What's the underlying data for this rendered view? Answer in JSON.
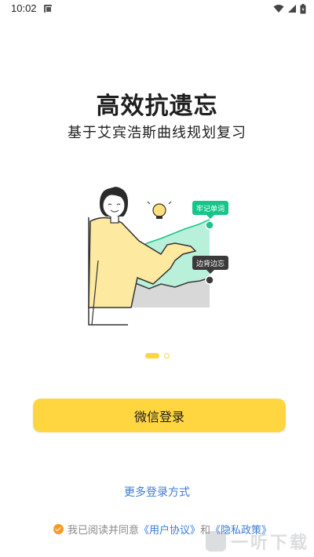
{
  "status_bar": {
    "time": "10:02",
    "icons": [
      "notification-icon",
      "wifi-icon",
      "signal-icon",
      "battery-icon"
    ]
  },
  "headline": "高效抗遗忘",
  "subhead": "基于艾宾浩斯曲线规划复习",
  "illustration": {
    "label_top": "牢记单词",
    "label_bottom": "边背边忘",
    "colors": {
      "green": "#19c48b",
      "dark": "#3a3a3a",
      "yellow": "#fde9a0"
    }
  },
  "pager": {
    "pages": 2,
    "active": 1
  },
  "wechat_login": "微信登录",
  "more_login": "更多登录方式",
  "agreement": {
    "prefix": "我已阅读并同意",
    "user_agreement": "《用户协议》",
    "and": "和",
    "privacy_policy": "《隐私政策》"
  },
  "watermark": "一听下载",
  "colors": {
    "accent": "#ffd640",
    "link": "#3a7bd5",
    "check": "#f59a23"
  }
}
